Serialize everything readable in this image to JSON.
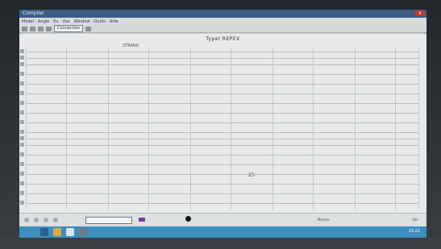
{
  "window": {
    "title": "Compiler",
    "close_label": "x"
  },
  "menu": [
    "Model",
    "Angle",
    "Ex",
    "Vue",
    "Window",
    "Outils",
    "Aide"
  ],
  "toolbar": {
    "field_label": "Connection"
  },
  "sheet": {
    "title": "Typel REPEX",
    "subheader": "STRAND"
  },
  "grid": {
    "center_value": "25"
  },
  "status_bar": {
    "left_text": "Mesure",
    "right_text": "Voir"
  },
  "taskbar": {
    "clock": "15:22"
  },
  "colors": {
    "titlebar": "#3c5d86",
    "taskbar": "#3d8fc0",
    "chip": "#7b3fa0"
  }
}
